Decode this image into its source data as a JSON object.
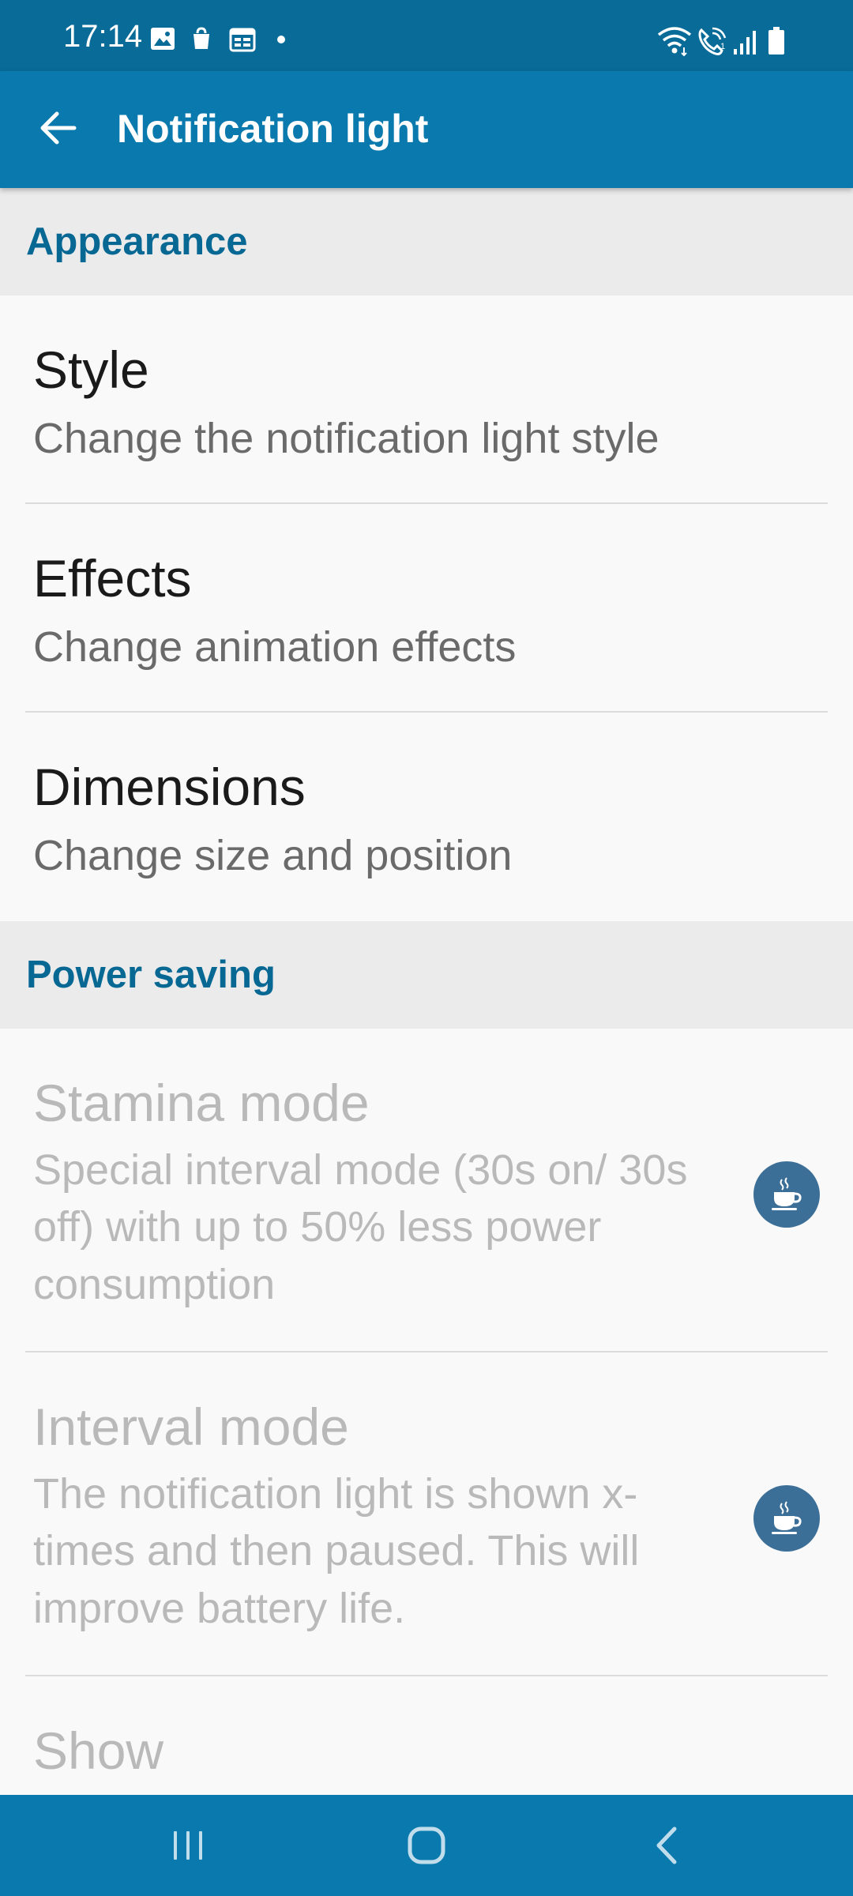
{
  "status_bar": {
    "time": "17:14",
    "left_icons": [
      "gallery-icon",
      "bag-icon",
      "calendar-icon",
      "dot-icon"
    ],
    "right_icons": [
      "wifi-icon",
      "wifi-call-icon",
      "signal-icon",
      "battery-icon"
    ]
  },
  "app_bar": {
    "title": "Notification light",
    "back_icon": "arrow-left-icon"
  },
  "sections": {
    "appearance": {
      "title": "Appearance",
      "items": [
        {
          "title": "Style",
          "summary": "Change the notification light style"
        },
        {
          "title": "Effects",
          "summary": "Change animation effects"
        },
        {
          "title": "Dimensions",
          "summary": "Change size and position"
        }
      ]
    },
    "power_saving": {
      "title": "Power saving",
      "items": [
        {
          "title": "Stamina mode",
          "summary": "Special interval mode (30s on/ 30s off) with up to 50% less power consumption",
          "badge_icon": "coffee-cup-icon",
          "enabled": false
        },
        {
          "title": "Interval mode",
          "summary": "The notification light is shown x-times and then paused. This will improve battery life.",
          "badge_icon": "coffee-cup-icon",
          "enabled": false
        },
        {
          "title": "Show",
          "summary": "",
          "enabled": false
        }
      ]
    }
  },
  "nav_bar": {
    "buttons": [
      "recents-icon",
      "home-icon",
      "back-icon"
    ]
  },
  "colors": {
    "status_bar": "#086b98",
    "app_bar": "#0a7aae",
    "section_title": "#086894",
    "section_bg": "#ebebeb",
    "badge": "#3c6f98"
  }
}
